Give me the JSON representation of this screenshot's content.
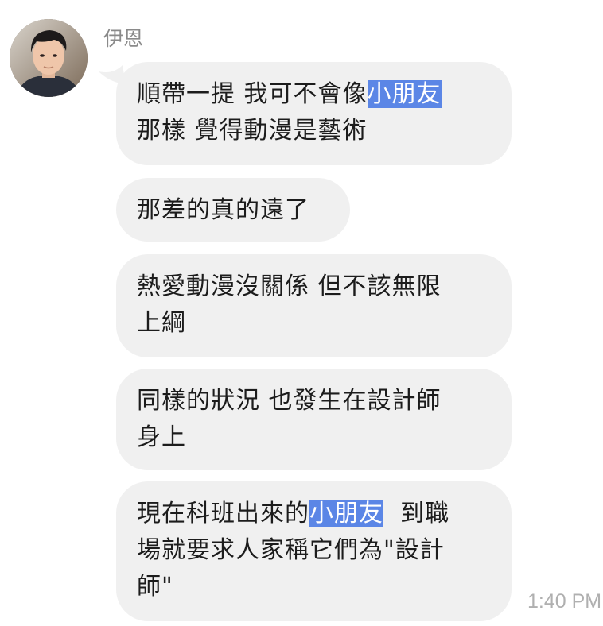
{
  "sender": {
    "name": "伊恩"
  },
  "messages": [
    {
      "lines": [
        {
          "before": "順帶一提  我可不會像",
          "highlight": "小朋友",
          "after": ""
        },
        {
          "before": "那樣  覺得動漫是藝術",
          "highlight": "",
          "after": ""
        }
      ]
    },
    {
      "lines": [
        {
          "before": "那差的真的遠了",
          "highlight": "",
          "after": ""
        }
      ]
    },
    {
      "lines": [
        {
          "before": "熱愛動漫沒關係  但不該無限",
          "highlight": "",
          "after": ""
        },
        {
          "before": "上綱",
          "highlight": "",
          "after": ""
        }
      ]
    },
    {
      "lines": [
        {
          "before": "同樣的狀況  也發生在設計師",
          "highlight": "",
          "after": ""
        },
        {
          "before": "身上",
          "highlight": "",
          "after": ""
        }
      ]
    },
    {
      "lines": [
        {
          "before": "現在科班出來的",
          "highlight": "小朋友",
          "after": "  到職"
        },
        {
          "before": "場就要求人家稱它們為\"設計",
          "highlight": "",
          "after": ""
        },
        {
          "before": "師\"",
          "highlight": "",
          "after": ""
        }
      ]
    }
  ],
  "timestamp": "1:40 PM",
  "colors": {
    "bubble": "#f0f0f0",
    "highlight": "#5b86e6",
    "name_text": "#8a8a8a",
    "timestamp_text": "#b0b0b0"
  },
  "icons": {
    "avatar": "user-photo-avatar"
  }
}
